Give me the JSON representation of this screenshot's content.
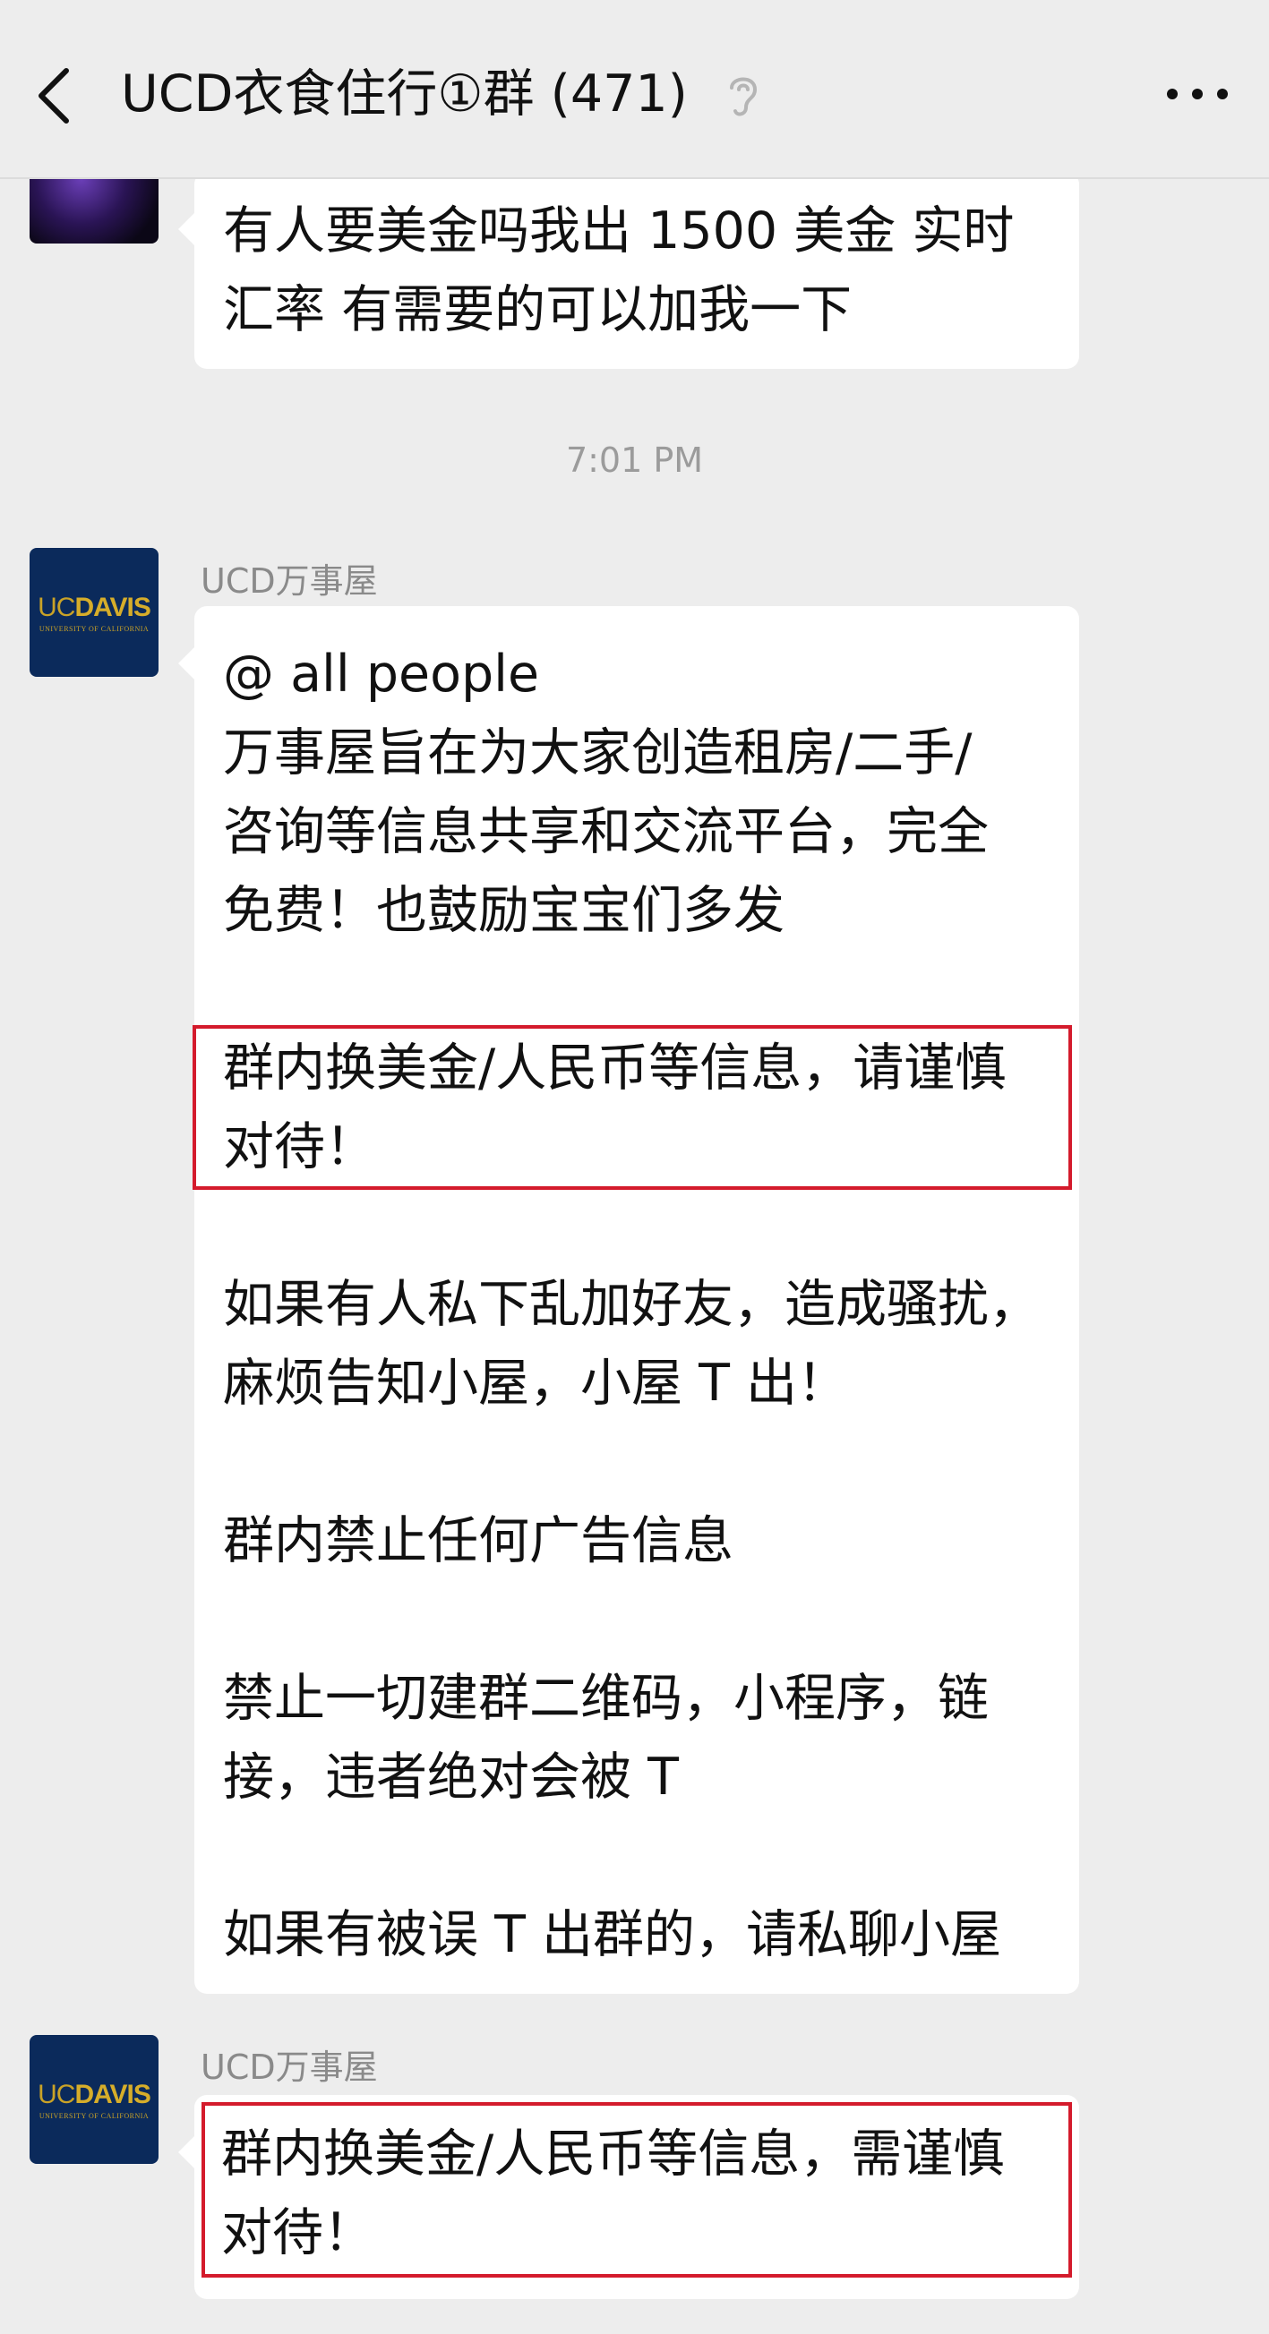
{
  "header": {
    "title": "UCD衣食住行①群 (471)",
    "back_icon": "chevron-left-icon",
    "mute_icon": "ear-muted-icon",
    "more_icon": "more-dots-icon"
  },
  "messages": [
    {
      "lines": [
        "有人要美金吗我出 1500 美金 实时",
        "汇率 有需要的可以加我一下"
      ]
    }
  ],
  "timestamp": "7:01 PM",
  "announcement": {
    "sender": "UCD万事屋",
    "avatar_text": {
      "uc": "UC",
      "davis": "DAVIS",
      "sub": "UNIVERSITY OF CALIFORNIA"
    },
    "para1": [
      "@ all people",
      "万事屋旨在为大家创造租房/二手/",
      "咨询等信息共享和交流平台，完全",
      "免费！也鼓励宝宝们多发"
    ],
    "para2": [
      "群内换美金/人民币等信息，请谨慎",
      "对待！"
    ],
    "para3": [
      "如果有人私下乱加好友，造成骚扰，",
      "麻烦告知小屋，小屋 T 出！"
    ],
    "para4": [
      "群内禁止任何广告信息"
    ],
    "para5": [
      "禁止一切建群二维码，小程序，链",
      "接，违者绝对会被 T"
    ],
    "para6": [
      "如果有被误 T 出群的，请私聊小屋"
    ]
  },
  "warning": {
    "sender": "UCD万事屋",
    "lines": [
      "群内换美金/人民币等信息，需谨慎",
      "对待！"
    ]
  },
  "colors": {
    "background": "#ededed",
    "bubble": "#ffffff",
    "highlight_border": "#d41b2c",
    "avatar_navy": "#0b2a5b",
    "avatar_gold": "#c9a227"
  }
}
